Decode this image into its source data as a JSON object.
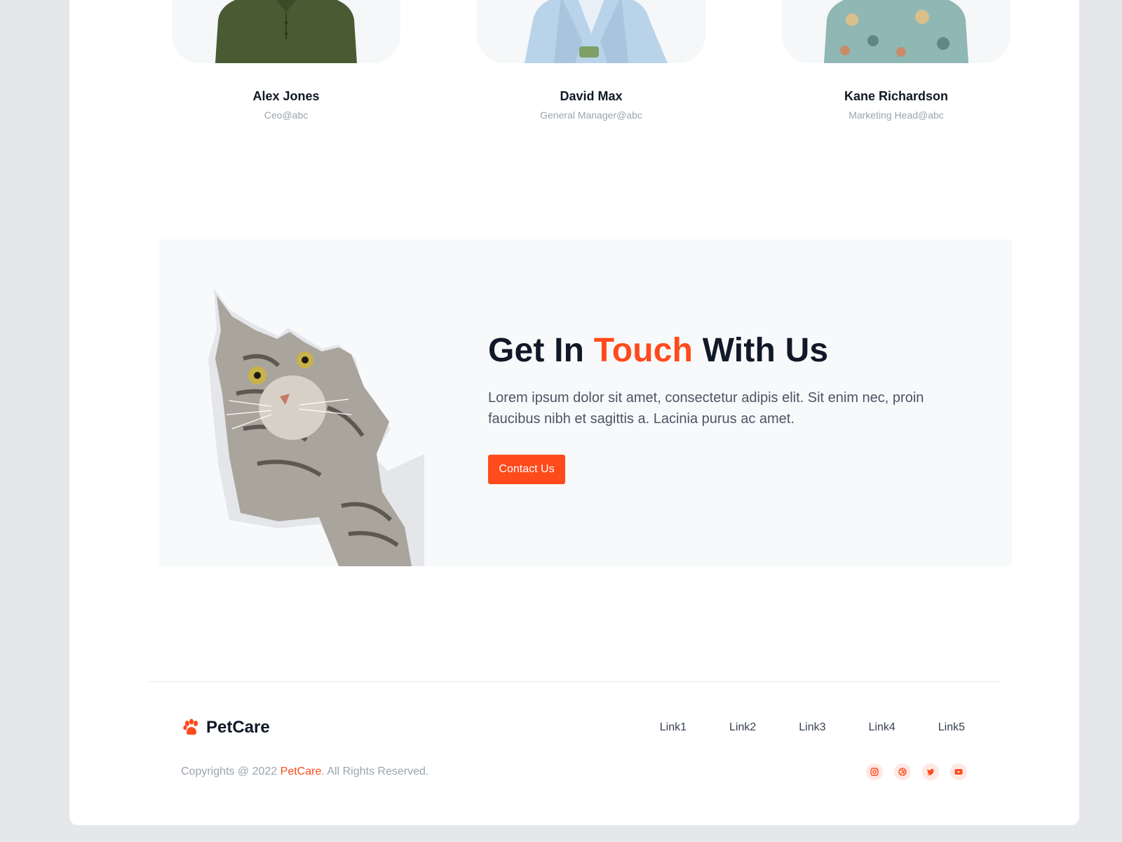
{
  "team": [
    {
      "name": "Alex Jones",
      "role": "Ceo@abc",
      "photo_icon": "person-green-polo-photo",
      "shirt_color": "#4a5a32"
    },
    {
      "name": "David Max",
      "role": "General Manager@abc",
      "photo_icon": "person-light-blue-blazer-photo",
      "shirt_color": "#b9d3ea"
    },
    {
      "name": "Kane Richardson",
      "role": "Marketing Head@abc",
      "photo_icon": "person-floral-shirt-photo",
      "shirt_color": "#8fb7b4"
    }
  ],
  "contact": {
    "title_start": "Get In ",
    "title_accent": "Touch",
    "title_end": " With Us",
    "text": "Lorem ipsum dolor sit amet, consectetur adipis elit. Sit enim nec, proin faucibus nibh et sagittis a. Lacinia purus ac amet.",
    "button_label": "Contact Us",
    "image_icon": "cat-tearing-paper-illustration"
  },
  "footer": {
    "brand": "PetCare",
    "brand_icon": "paw-icon",
    "links": [
      "Link1",
      "Link2",
      "Link3",
      "Link4",
      "Link5"
    ],
    "copyright_prefix": "Copyrights @ 2022 ",
    "copyright_brand": "PetCare",
    "copyright_suffix": ". All Rights Reserved.",
    "socials": [
      "instagram-icon",
      "dribbble-icon",
      "twitter-icon",
      "youtube-icon"
    ]
  },
  "colors": {
    "accent": "#ff4a1c",
    "heading": "#111827",
    "muted": "#9ca3af",
    "background": "#e5e7eb",
    "card_bg": "#f8f9fb"
  }
}
